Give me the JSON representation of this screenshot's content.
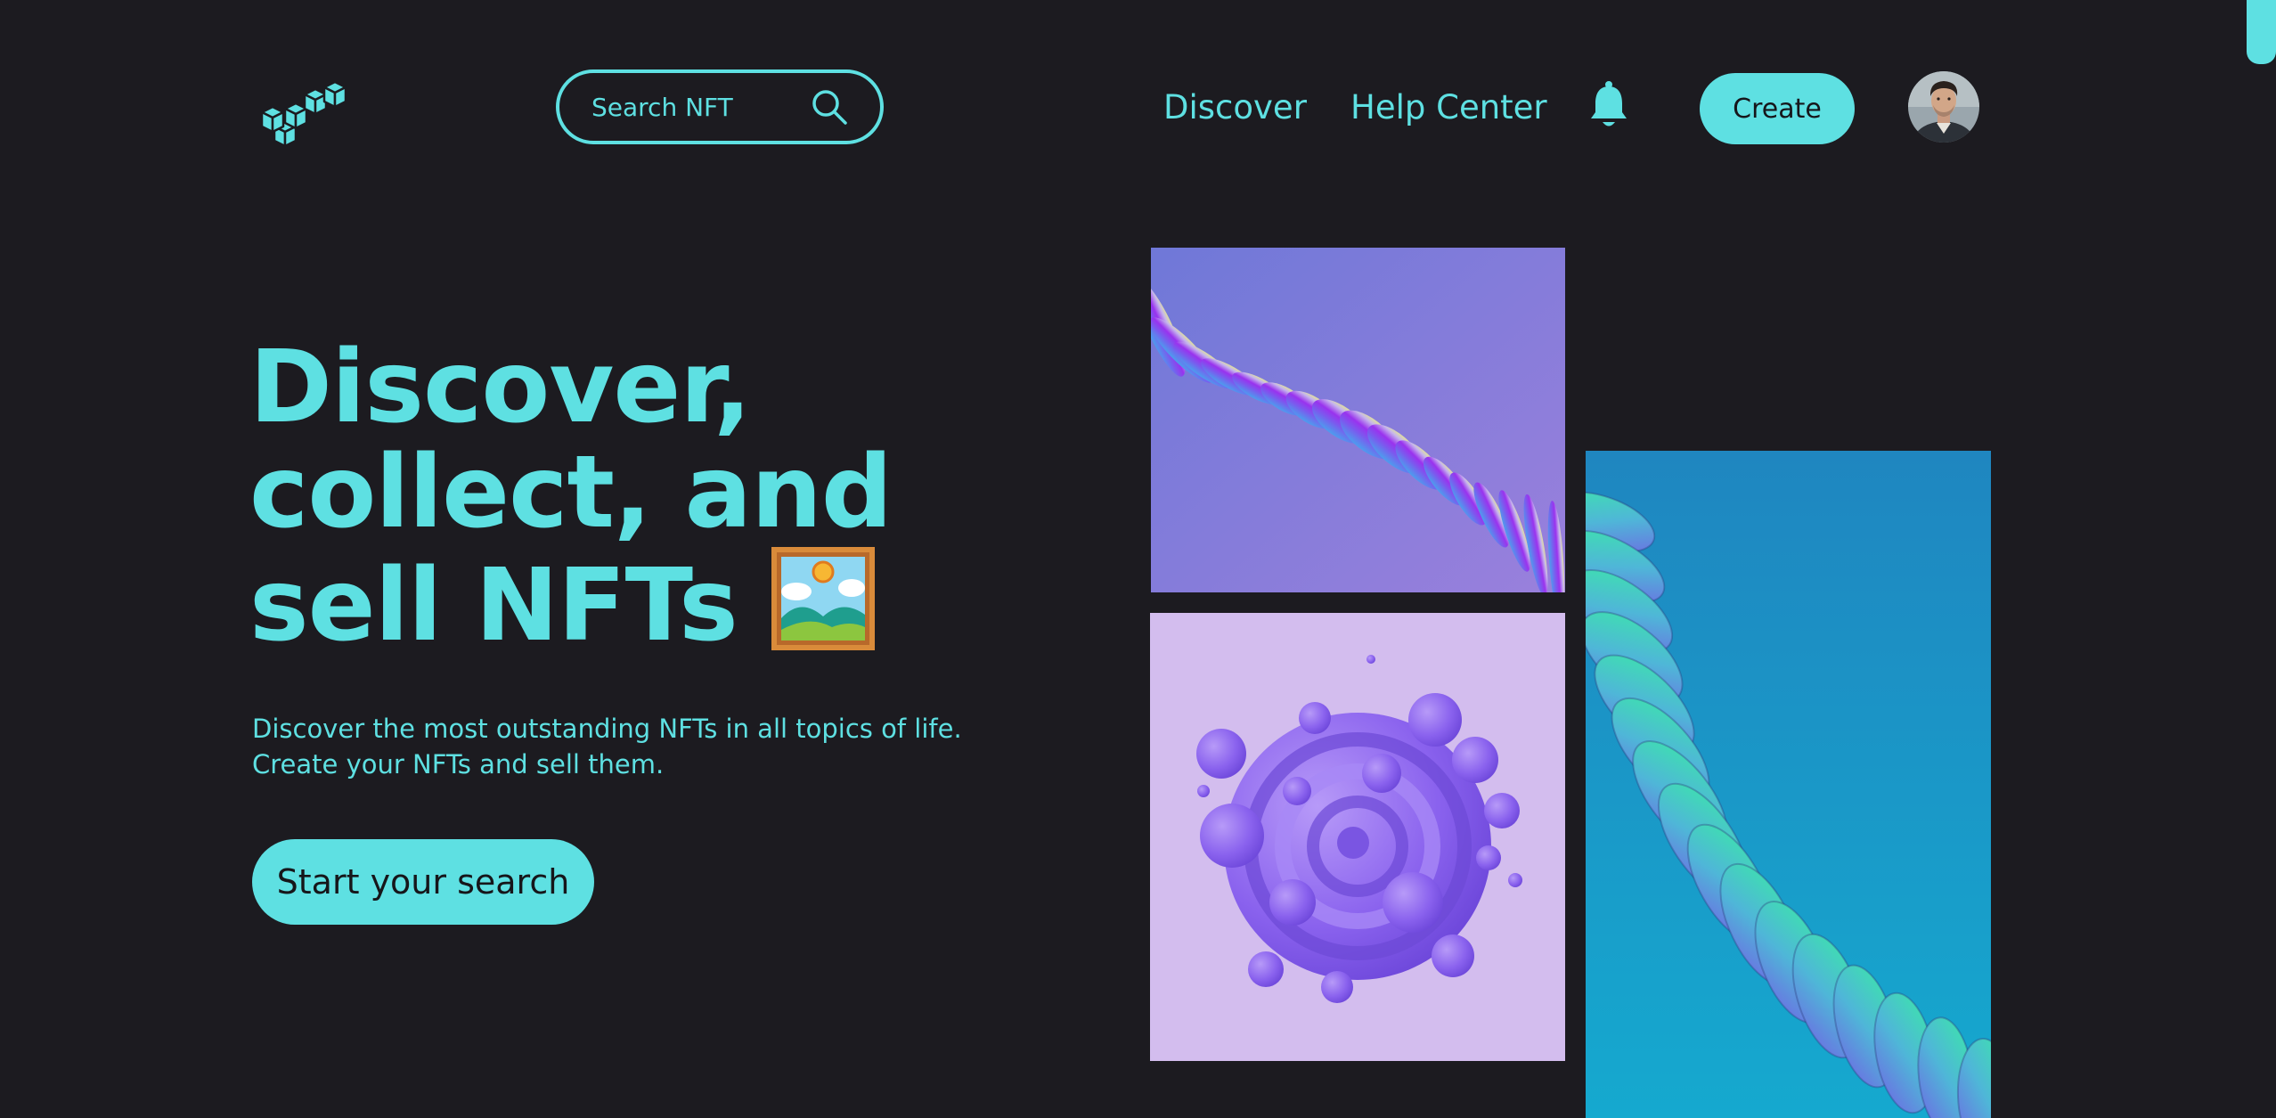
{
  "colors": {
    "background": "#1c1b20",
    "accent": "#5ee0e2",
    "button_text": "#16161a"
  },
  "header": {
    "logo_icon": "stacked-cubes-icon",
    "search": {
      "placeholder": "Search NFT",
      "icon": "search-icon"
    },
    "nav": {
      "discover": "Discover",
      "help_center": "Help Center"
    },
    "notification_icon": "bell-icon",
    "create_label": "Create",
    "avatar_icon": "user-avatar"
  },
  "hero": {
    "title_line1": "Discover,",
    "title_line2": "collect, and",
    "title_line3": "sell NFTs",
    "title_icon": "framed-picture-icon",
    "description_line1": "Discover the most outstanding NFTs in all topics of life.",
    "description_line2": "Create your NFTs and sell them.",
    "cta_label": "Start your search"
  },
  "gallery": {
    "items": [
      {
        "name": "purple-wave-art",
        "palette": [
          "#7a86e0",
          "#8f5cf0",
          "#dfe6a0"
        ]
      },
      {
        "name": "violet-bubble-swirl-art",
        "palette": [
          "#d4bdec",
          "#9a6ef0",
          "#7c56e8"
        ]
      },
      {
        "name": "teal-ribbon-art",
        "palette": [
          "#1a9ecf",
          "#3fe0b0",
          "#6d68e6"
        ]
      }
    ]
  }
}
